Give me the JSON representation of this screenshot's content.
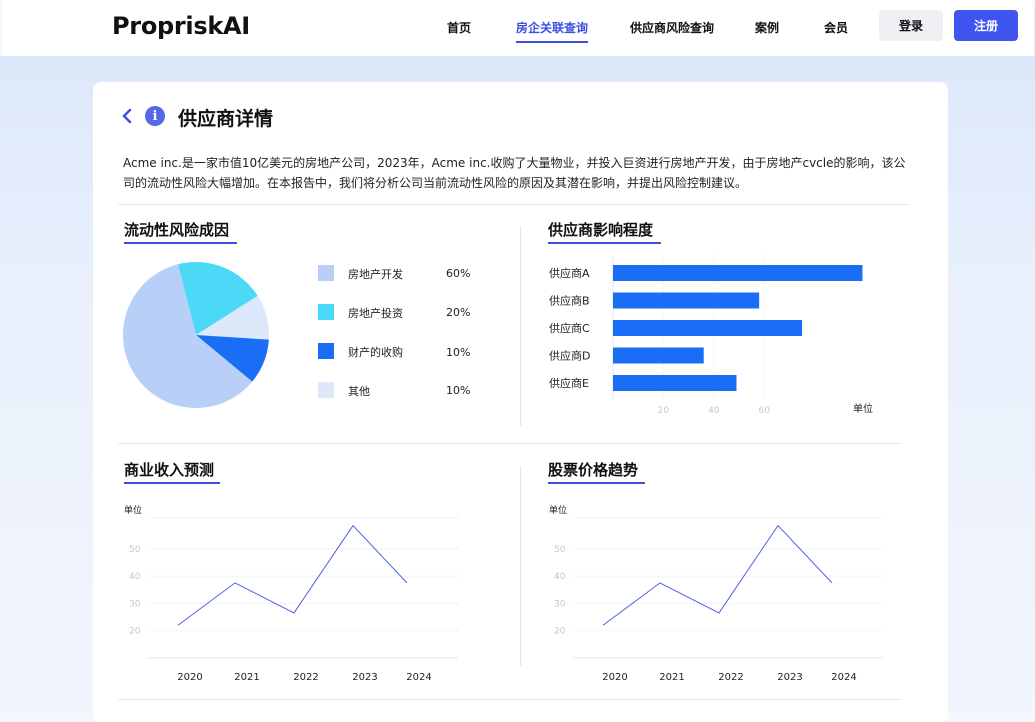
{
  "header": {
    "logo": "PropriskAI",
    "nav": [
      {
        "label": "首页",
        "active": false
      },
      {
        "label": "房企关联查询",
        "active": true
      },
      {
        "label": "供应商风险查询",
        "active": false
      },
      {
        "label": "案例",
        "active": false
      },
      {
        "label": "会员",
        "active": false
      }
    ],
    "login_label": "登录",
    "register_label": "注册"
  },
  "colors": {
    "accent": "#3b50e0",
    "bar": "#1a6ef5",
    "line": "#4e63e6"
  },
  "page": {
    "title": "供应商详情",
    "description": "Acme inc.是一家市值10亿美元的房地产公司，2023年，Acme inc.收购了大量物业，并投入巨资进行房地产开发，由于房地产cvcle的影响，该公司的流动性风险大幅增加。在本报告中，我们将分析公司当前流动性风险的原因及其潜在影响，并提出风险控制建议。"
  },
  "sections": {
    "pie_title": "流动性风险成因",
    "bar_title": "供应商影响程度",
    "revenue_title": "商业收入预测",
    "stock_title": "股票价格趋势"
  },
  "chart_data": [
    {
      "type": "pie",
      "title": "流动性风险成因",
      "labels": [
        "房地产开发",
        "房地产投资",
        "财产的收购",
        "其他"
      ],
      "value_labels": [
        "60%",
        "20%",
        "10%",
        "10%"
      ],
      "values": [
        60,
        20,
        10,
        10
      ],
      "colors": [
        "#b8cff8",
        "#4cd9f7",
        "#1a6ef5",
        "#dde9fb"
      ]
    },
    {
      "type": "bar",
      "title": "供应商影响程度",
      "orientation": "horizontal",
      "categories": [
        "供应商A",
        "供应商B",
        "供应商C",
        "供应商D",
        "供应商E"
      ],
      "values": [
        99,
        58,
        75,
        36,
        49
      ],
      "xticks": [
        "20",
        "40",
        "60"
      ],
      "unit_label": "单位",
      "xlim": [
        0,
        100
      ]
    },
    {
      "type": "line",
      "title": "商业收入预测",
      "x": [
        "2020",
        "2021",
        "2022",
        "2023",
        "2024"
      ],
      "y": [
        22,
        37.5,
        26.5,
        58.5,
        37.5
      ],
      "yticks": [
        "20",
        "30",
        "40",
        "50"
      ],
      "unit_label": "单位",
      "ylim": [
        10,
        62
      ]
    },
    {
      "type": "line",
      "title": "股票价格趋势",
      "x": [
        "2020",
        "2021",
        "2022",
        "2023",
        "2024"
      ],
      "y": [
        22,
        37.5,
        26.5,
        58.5,
        37.5
      ],
      "yticks": [
        "20",
        "30",
        "40",
        "50"
      ],
      "unit_label": "单位",
      "ylim": [
        10,
        62
      ]
    }
  ]
}
